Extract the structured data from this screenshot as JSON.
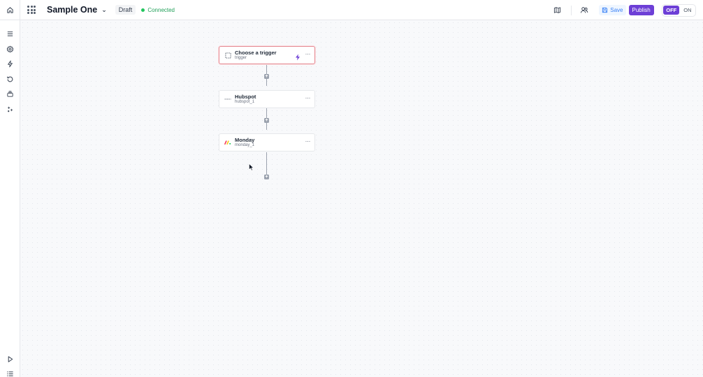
{
  "header": {
    "title": "Sample One",
    "draft_label": "Draft",
    "status_label": "Connected",
    "save_label": "Save",
    "publish_label": "Publish",
    "toggle_off": "OFF",
    "toggle_on": "ON"
  },
  "workflow": {
    "nodes": [
      {
        "title": "Choose a trigger",
        "subtitle": "trigger"
      },
      {
        "title": "Hubspot",
        "subtitle": "hubspot_1"
      },
      {
        "title": "Monday",
        "subtitle": "monday_1"
      }
    ]
  },
  "colors": {
    "accent": "#6d3fd6",
    "connected": "#22c55e",
    "trigger_border": "#e58b93"
  },
  "icons": {
    "sidebar": [
      "menu-icon",
      "settings-icon",
      "bolt-icon",
      "history-icon",
      "layers-icon",
      "integrations-icon",
      "play-icon",
      "list-icon"
    ]
  }
}
